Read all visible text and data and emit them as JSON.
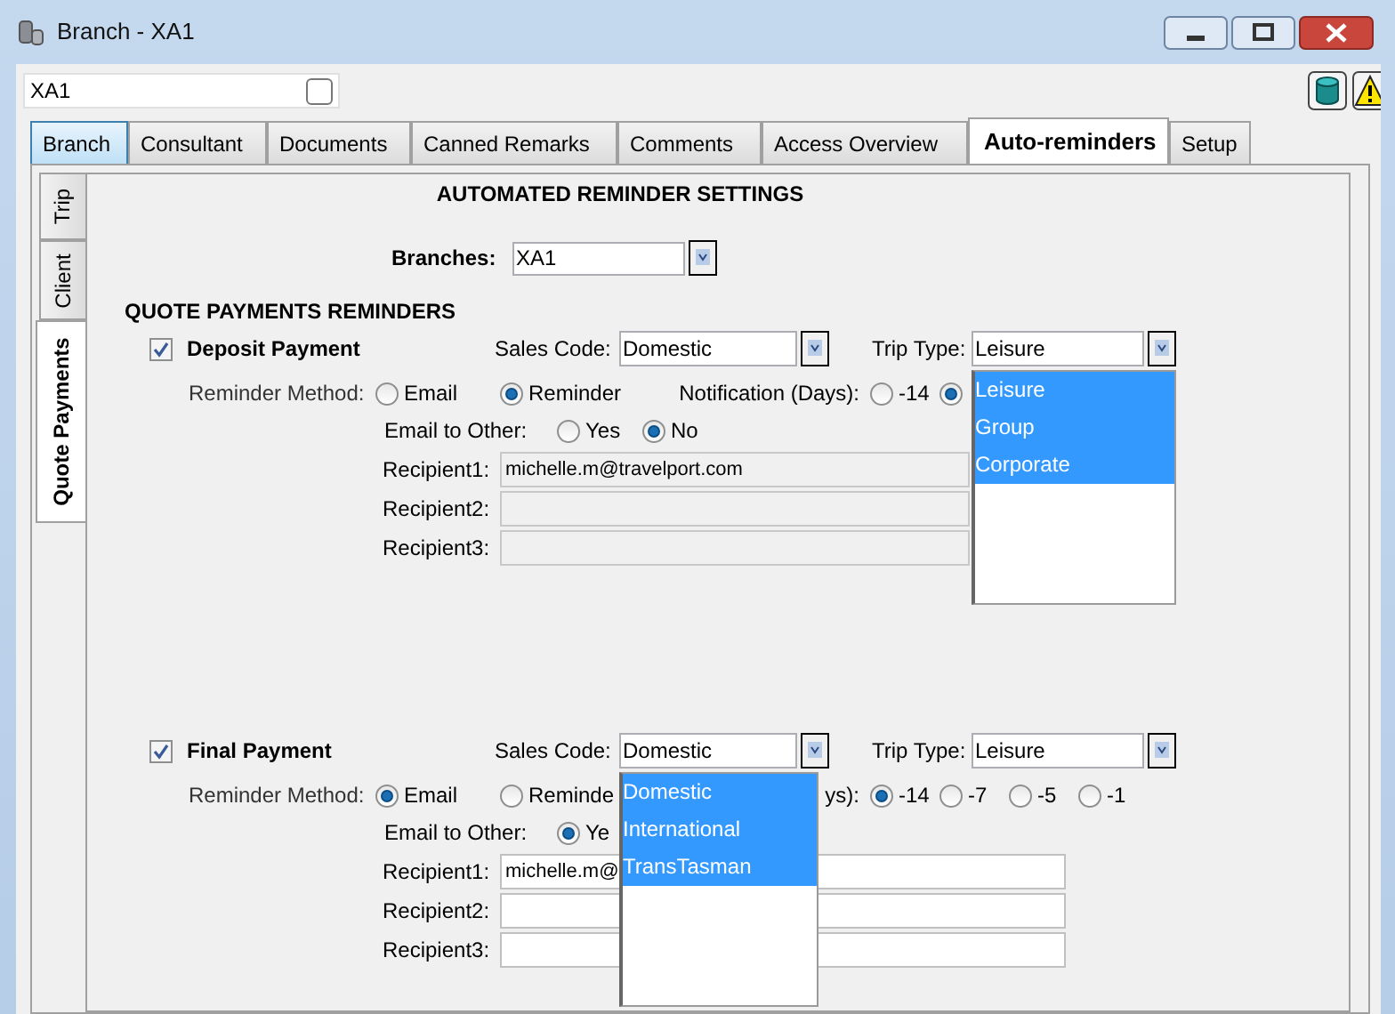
{
  "window": {
    "title": "Branch - XA1"
  },
  "record": {
    "value": "XA1",
    "checked": false
  },
  "tabs": [
    {
      "label": "Branch",
      "selected": false,
      "hovered": true
    },
    {
      "label": "Consultant",
      "selected": false,
      "hovered": false
    },
    {
      "label": "Documents",
      "selected": false,
      "hovered": false
    },
    {
      "label": "Canned Remarks",
      "selected": false,
      "hovered": false
    },
    {
      "label": "Comments",
      "selected": false,
      "hovered": false
    },
    {
      "label": "Access Overview",
      "selected": false,
      "hovered": false
    },
    {
      "label": "Auto-reminders",
      "selected": true,
      "hovered": false
    },
    {
      "label": "Setup",
      "selected": false,
      "hovered": false
    }
  ],
  "side_tabs": [
    {
      "label": "Trip",
      "selected": false
    },
    {
      "label": "Client",
      "selected": false
    },
    {
      "label": "Quote Payments",
      "selected": true
    }
  ],
  "heading": "AUTOMATED REMINDER SETTINGS",
  "branches": {
    "label": "Branches:",
    "value": "XA1"
  },
  "section_title": "QUOTE PAYMENTS REMINDERS",
  "reminders": [
    {
      "label": "Deposit Payment",
      "checked": true,
      "sales_code": {
        "label": "Sales Code:",
        "value": "Domestic"
      },
      "trip_type": {
        "label": "Trip Type:",
        "value": "Leisure",
        "options": [
          {
            "label": "Leisure",
            "highlighted": true
          },
          {
            "label": "Group",
            "highlighted": true
          },
          {
            "label": "Corporate",
            "highlighted": true
          }
        ]
      },
      "method": {
        "label": "Reminder Method:",
        "options": [
          {
            "label": "Email",
            "selected": false
          },
          {
            "label": "Reminder",
            "selected": true
          }
        ]
      },
      "notification": {
        "label": "Notification (Days):",
        "options": [
          {
            "label": "-14",
            "selected": false
          },
          {
            "selected": true
          }
        ]
      },
      "email_other": {
        "label": "Email to Other:",
        "options": [
          {
            "label": "Yes",
            "selected": false
          },
          {
            "label": "No",
            "selected": true
          }
        ]
      },
      "recipients": [
        {
          "label": "Recipient1:",
          "value": "michelle.m@travelport.com",
          "disabled": true
        },
        {
          "label": "Recipient2:",
          "disabled": true
        },
        {
          "label": "Recipient3:",
          "disabled": true
        }
      ]
    },
    {
      "label": "Final Payment",
      "checked": true,
      "sales_code": {
        "label": "Sales Code:",
        "value": "Domestic",
        "options": [
          {
            "label": "Domestic",
            "highlighted": true
          },
          {
            "label": "International",
            "highlighted": true
          },
          {
            "label": "TransTasman",
            "highlighted": true
          }
        ]
      },
      "trip_type": {
        "label": "Trip Type:",
        "value": "Leisure"
      },
      "method": {
        "label": "Reminder Method:",
        "options": [
          {
            "label": "Email",
            "selected": true
          },
          {
            "label": "Reminde",
            "selected": false
          }
        ]
      },
      "notification": {
        "label": "ys):",
        "options": [
          {
            "label": "-14",
            "selected": true
          },
          {
            "label": "-7",
            "selected": false
          },
          {
            "label": "-5",
            "selected": false
          },
          {
            "label": "-1",
            "selected": false
          }
        ]
      },
      "email_other": {
        "label": "Email to Other:",
        "options": [
          {
            "label": "Ye",
            "selected": true
          }
        ]
      },
      "recipients": [
        {
          "label": "Recipient1:",
          "value": "michelle.m@",
          "disabled": false
        },
        {
          "label": "Recipient2:",
          "disabled": false
        },
        {
          "label": "Recipient3:",
          "disabled": false
        }
      ]
    }
  ]
}
